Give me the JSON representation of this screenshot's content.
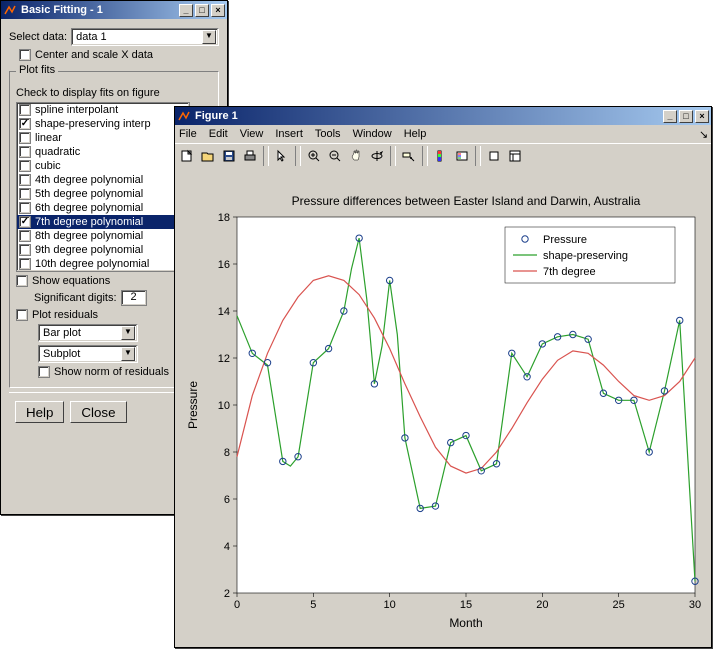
{
  "bf": {
    "title": "Basic Fitting - 1",
    "select_data_label": "Select data:",
    "select_data_value": "data 1",
    "center_scale_label": "Center and scale X data",
    "group_title": "Plot fits",
    "check_display_label": "Check to display fits on figure",
    "fits": [
      {
        "label": "spline interpolant",
        "checked": false,
        "selected": false
      },
      {
        "label": "shape-preserving interp",
        "checked": true,
        "selected": false
      },
      {
        "label": "linear",
        "checked": false,
        "selected": false
      },
      {
        "label": "quadratic",
        "checked": false,
        "selected": false
      },
      {
        "label": "cubic",
        "checked": false,
        "selected": false
      },
      {
        "label": "4th degree polynomial",
        "checked": false,
        "selected": false
      },
      {
        "label": "5th degree polynomial",
        "checked": false,
        "selected": false
      },
      {
        "label": "6th degree polynomial",
        "checked": false,
        "selected": false
      },
      {
        "label": "7th degree polynomial",
        "checked": true,
        "selected": true
      },
      {
        "label": "8th degree polynomial",
        "checked": false,
        "selected": false
      },
      {
        "label": "9th degree polynomial",
        "checked": false,
        "selected": false
      },
      {
        "label": "10th degree polynomial",
        "checked": false,
        "selected": false
      }
    ],
    "show_eq_label": "Show equations",
    "sig_digits_label": "Significant digits:",
    "sig_digits_value": "2",
    "plot_resid_label": "Plot residuals",
    "resid_type": "Bar plot",
    "resid_where": "Subplot",
    "show_norm_label": "Show norm of residuals",
    "help_btn": "Help",
    "close_btn": "Close"
  },
  "fig": {
    "title": "Figure 1",
    "menus": [
      "File",
      "Edit",
      "View",
      "Insert",
      "Tools",
      "Window",
      "Help"
    ],
    "tooltips": {
      "new": "New Figure",
      "open": "Open",
      "save": "Save",
      "print": "Print",
      "pointer": "Edit Plot",
      "zoomin": "Zoom In",
      "zoomout": "Zoom Out",
      "pan": "Pan",
      "rotate": "Rotate 3D",
      "cursor": "Data Cursor",
      "colorbar": "Insert Colorbar",
      "legend": "Insert Legend",
      "hide": "Hide Plot Tools",
      "show": "Show Plot Tools"
    }
  },
  "chart_data": {
    "type": "line",
    "title": "Pressure differences between Easter Island and Darwin, Australia",
    "xlabel": "Month",
    "ylabel": "Pressure",
    "xlim": [
      0,
      30
    ],
    "ylim": [
      2,
      18
    ],
    "xticks": [
      0,
      5,
      10,
      15,
      20,
      25,
      30
    ],
    "yticks": [
      2,
      4,
      6,
      8,
      10,
      12,
      14,
      16,
      18
    ],
    "legend": [
      "Pressure",
      "shape-preserving",
      "7th degree"
    ],
    "pressure_points": [
      [
        1,
        12.2
      ],
      [
        2,
        11.8
      ],
      [
        3,
        7.6
      ],
      [
        4,
        7.8
      ],
      [
        5,
        11.8
      ],
      [
        6,
        12.4
      ],
      [
        7,
        14.0
      ],
      [
        8,
        17.1
      ],
      [
        9,
        10.9
      ],
      [
        10,
        15.3
      ],
      [
        11,
        8.6
      ],
      [
        12,
        5.6
      ],
      [
        13,
        5.7
      ],
      [
        14,
        8.4
      ],
      [
        15,
        8.7
      ],
      [
        16,
        7.2
      ],
      [
        17,
        7.5
      ],
      [
        18,
        12.2
      ],
      [
        19,
        11.2
      ],
      [
        20,
        12.6
      ],
      [
        21,
        12.9
      ],
      [
        22,
        13.0
      ],
      [
        23,
        12.8
      ],
      [
        24,
        10.5
      ],
      [
        25,
        10.2
      ],
      [
        26,
        10.2
      ],
      [
        27,
        8.0
      ],
      [
        28,
        10.6
      ],
      [
        29,
        13.6
      ],
      [
        30,
        2.5
      ]
    ],
    "shape_preserving": [
      [
        0,
        13.8
      ],
      [
        1,
        12.2
      ],
      [
        2,
        11.7
      ],
      [
        3,
        7.6
      ],
      [
        3.5,
        7.4
      ],
      [
        4,
        7.8
      ],
      [
        5,
        11.8
      ],
      [
        6,
        12.4
      ],
      [
        7,
        14.0
      ],
      [
        7.5,
        15.8
      ],
      [
        8,
        17.1
      ],
      [
        8.5,
        14.5
      ],
      [
        9,
        10.9
      ],
      [
        9.5,
        12.5
      ],
      [
        10,
        15.3
      ],
      [
        10.5,
        13.0
      ],
      [
        11,
        8.6
      ],
      [
        12,
        5.6
      ],
      [
        13,
        5.7
      ],
      [
        14,
        8.4
      ],
      [
        15,
        8.7
      ],
      [
        16,
        7.2
      ],
      [
        17,
        7.5
      ],
      [
        18,
        12.2
      ],
      [
        19,
        11.2
      ],
      [
        20,
        12.6
      ],
      [
        21,
        12.9
      ],
      [
        22,
        13.0
      ],
      [
        23,
        12.8
      ],
      [
        24,
        10.5
      ],
      [
        25,
        10.2
      ],
      [
        26,
        10.2
      ],
      [
        27,
        8.0
      ],
      [
        28,
        10.6
      ],
      [
        29,
        13.6
      ],
      [
        30,
        2.5
      ]
    ],
    "seventh_degree": [
      [
        0,
        7.8
      ],
      [
        1,
        10.4
      ],
      [
        2,
        12.2
      ],
      [
        3,
        13.6
      ],
      [
        4,
        14.6
      ],
      [
        5,
        15.3
      ],
      [
        6,
        15.5
      ],
      [
        7,
        15.3
      ],
      [
        8,
        14.7
      ],
      [
        9,
        13.7
      ],
      [
        10,
        12.4
      ],
      [
        11,
        10.9
      ],
      [
        12,
        9.5
      ],
      [
        13,
        8.2
      ],
      [
        14,
        7.4
      ],
      [
        15,
        7.1
      ],
      [
        16,
        7.3
      ],
      [
        17,
        8.0
      ],
      [
        18,
        9.0
      ],
      [
        19,
        10.1
      ],
      [
        20,
        11.1
      ],
      [
        21,
        11.9
      ],
      [
        22,
        12.3
      ],
      [
        23,
        12.2
      ],
      [
        24,
        11.7
      ],
      [
        25,
        11.0
      ],
      [
        26,
        10.4
      ],
      [
        27,
        10.2
      ],
      [
        28,
        10.4
      ],
      [
        29,
        11.0
      ],
      [
        30,
        12.0
      ]
    ]
  }
}
